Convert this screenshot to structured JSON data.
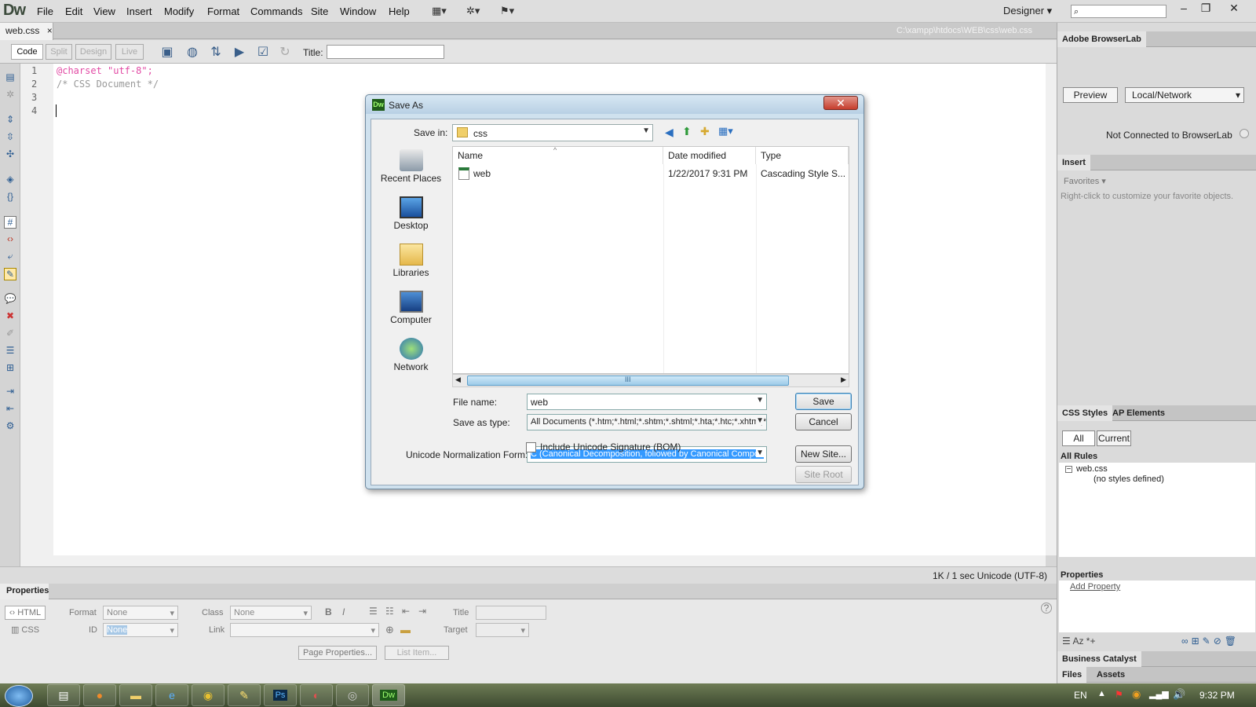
{
  "app": {
    "logo": "Dw",
    "menu": [
      "File",
      "Edit",
      "View",
      "Insert",
      "Modify",
      "Format",
      "Commands",
      "Site",
      "Window",
      "Help"
    ],
    "workspace": "Designer",
    "toolbar_icons": [
      "layout-icon",
      "gear-icon",
      "extend-icon"
    ]
  },
  "document": {
    "tab_name": "web.css",
    "tab_close": "×",
    "path": "C:\\xampp\\htdocs\\WEB\\css\\web.css",
    "views": [
      "Code",
      "Split",
      "Design",
      "Live"
    ],
    "title_label": "Title:",
    "title_value": "",
    "code_lines": [
      {
        "num": "1",
        "text": "@charset \"utf-8\";",
        "color": "#e24aa4"
      },
      {
        "num": "2",
        "text": "/* CSS Document */",
        "color": "#999999"
      },
      {
        "num": "3",
        "text": "",
        "color": "#000000"
      },
      {
        "num": "4",
        "text": "",
        "color": "#000000"
      }
    ],
    "status": "1K / 1 sec  Unicode (UTF-8)"
  },
  "properties": {
    "tab": "Properties",
    "html_label": "HTML",
    "css_label": "CSS",
    "format_label": "Format",
    "format_value": "None",
    "class_label": "Class",
    "class_value": "None",
    "id_label": "ID",
    "id_value": "None",
    "link_label": "Link",
    "title_label": "Title",
    "target_label": "Target",
    "page_properties": "Page Properties...",
    "list_item": "List Item..."
  },
  "right_panel": {
    "browserlab_title": "Adobe BrowserLab",
    "preview_btn": "Preview",
    "local_network": "Local/Network",
    "browserlab_status": "Not Connected to BrowserLab",
    "insert_title": "Insert",
    "favorites": "Favorites",
    "favorites_hint": "Right-click to customize your favorite objects.",
    "css_styles_tab": "CSS Styles",
    "ap_elements_tab": "AP Elements",
    "all_btn": "All",
    "current_btn": "Current",
    "all_rules": "All Rules",
    "rule_file": "web.css",
    "rule_empty": "(no styles defined)",
    "properties_title": "Properties",
    "add_property": "Add Property",
    "business_catalyst": "Business Catalyst",
    "files_tab": "Files",
    "assets_tab": "Assets"
  },
  "dialog": {
    "title": "Save As",
    "close": "✕",
    "save_in_label": "Save in:",
    "save_in_value": "css",
    "places": [
      "Recent Places",
      "Desktop",
      "Libraries",
      "Computer",
      "Network"
    ],
    "columns": [
      "Name",
      "Date modified",
      "Type"
    ],
    "files": [
      {
        "name": "web",
        "date": "1/22/2017 9:31 PM",
        "type": "Cascading Style S..."
      }
    ],
    "file_name_label": "File name:",
    "file_name_value": "web",
    "save_as_type_label": "Save as type:",
    "save_as_type_value": "All Documents (*.htm;*.html;*.shtm;*.shtml;*.hta;*.htc;*.xhtml;*.",
    "unicode_label": "Unicode Normalization Form:",
    "unicode_value": "C (Canonical Decomposition, followed by Canonical Compos",
    "bom_label": "Include Unicode Signature (BOM)",
    "save_btn": "Save",
    "cancel_btn": "Cancel",
    "new_site_btn": "New Site...",
    "site_root_btn": "Site Root"
  },
  "taskbar": {
    "language": "EN",
    "clock": "9:32 PM",
    "apps": [
      "Notepad",
      "Firefox",
      "Explorer",
      "Internet Explorer",
      "Chrome",
      "Tools",
      "Ps",
      "Media",
      "Utility",
      "Dw"
    ]
  }
}
